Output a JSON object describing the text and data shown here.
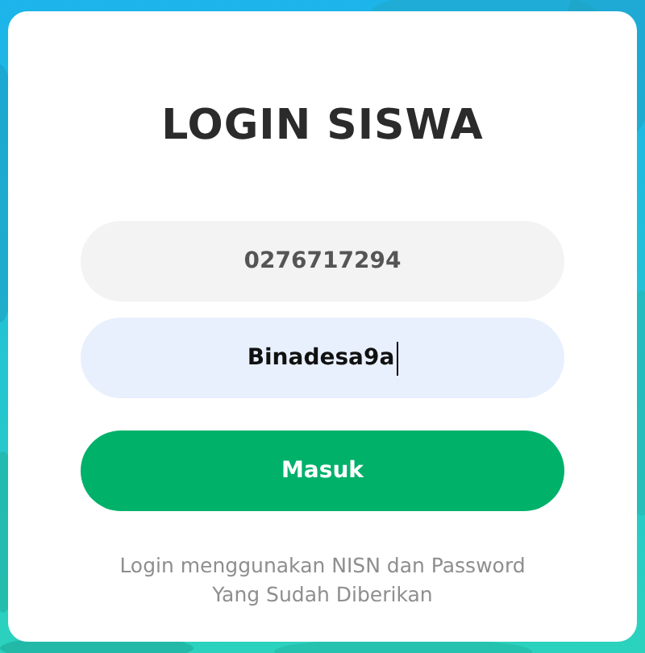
{
  "title": "LOGIN SISWA",
  "fields": [
    {
      "value": "0276717294",
      "focused": false
    },
    {
      "value": "Binadesa9a",
      "focused": true
    }
  ],
  "submit_button": "Masuk",
  "help_text": [
    "Login menggunakan NISN dan Password",
    "Yang Sudah Diberikan"
  ]
}
